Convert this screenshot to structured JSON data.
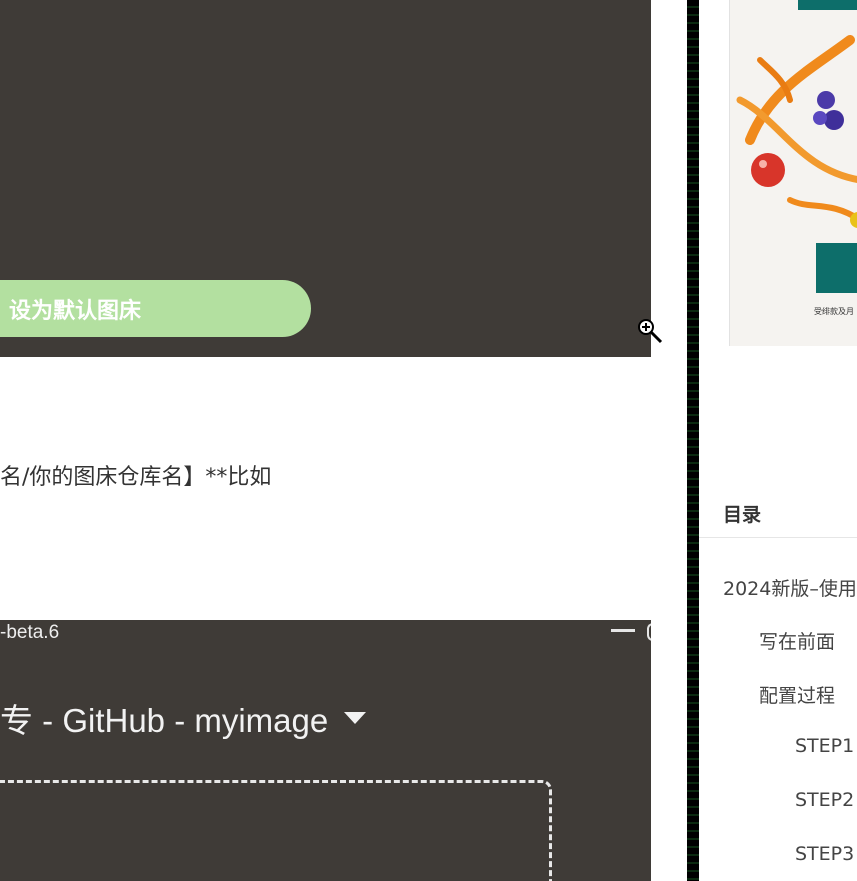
{
  "upload_screenshot_top": {
    "set_default_button": "设为默认图床"
  },
  "article": {
    "paragraph_fragment": "名/你的图床仓库名】**比如"
  },
  "upload_screenshot_bottom": {
    "window_title": "-beta.6",
    "uploader_title": "专 - GitHub - myimage"
  },
  "ad_image": {
    "caption": "受绯款及月"
  },
  "toc": {
    "title": "目录",
    "items": [
      {
        "label": "2024新版–使用"
      },
      {
        "label": "写在前面"
      },
      {
        "label": "配置过程"
      },
      {
        "label": "STEP1"
      },
      {
        "label": "STEP2"
      },
      {
        "label": "STEP3"
      }
    ]
  },
  "colors": {
    "screenshot_bg": "#3f3b37",
    "button_green": "#b3e0a0",
    "accent_teal": "#0d6e6a"
  }
}
